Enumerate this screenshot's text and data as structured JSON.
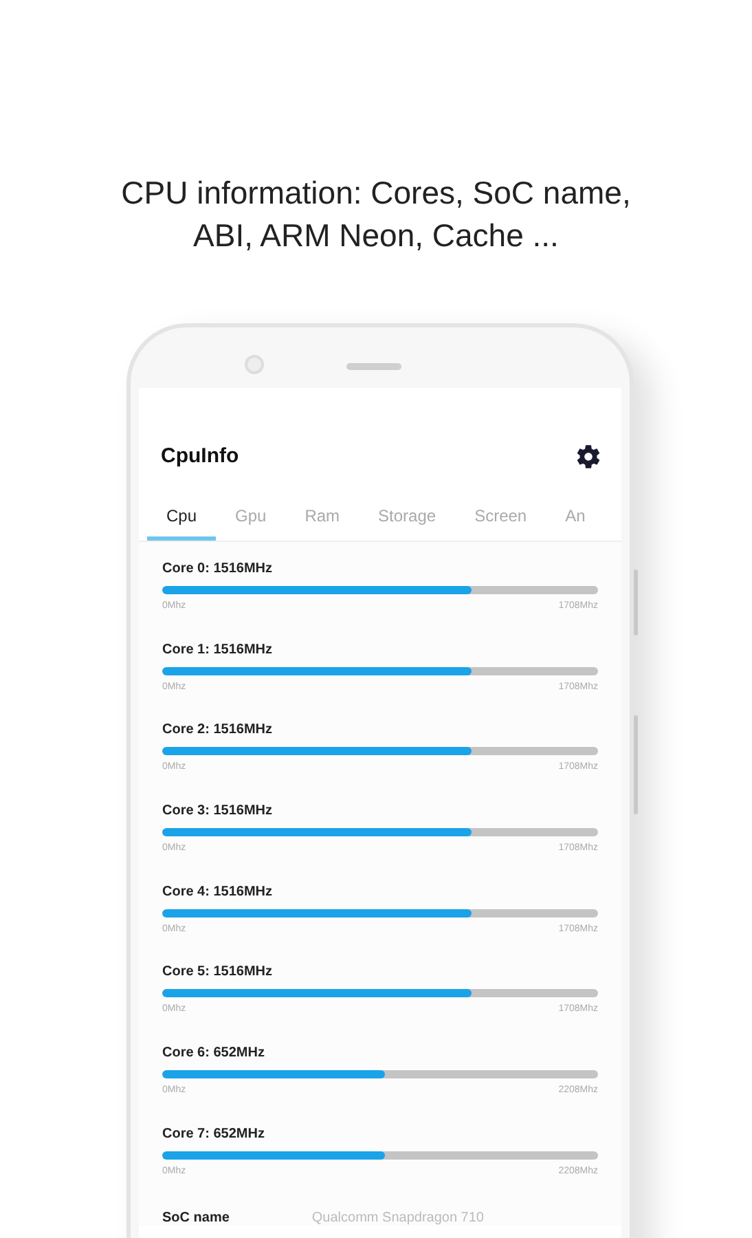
{
  "caption": [
    "CPU information: Cores, SoC name,",
    "ABI, ARM Neon, Cache ..."
  ],
  "app_bar": {
    "title": "CpuInfo"
  },
  "tabs": [
    {
      "label": "Cpu",
      "selected": true
    },
    {
      "label": "Gpu",
      "selected": false
    },
    {
      "label": "Ram",
      "selected": false
    },
    {
      "label": "Storage",
      "selected": false
    },
    {
      "label": "Screen",
      "selected": false
    },
    {
      "label": "An",
      "selected": false
    }
  ],
  "cores": [
    {
      "label": "Core 0: 1516MHz",
      "level": 0.71,
      "min": "0Mhz",
      "max": "1708Mhz"
    },
    {
      "label": "Core 1: 1516MHz",
      "level": 0.71,
      "min": "0Mhz",
      "max": "1708Mhz"
    },
    {
      "label": "Core 2: 1516MHz",
      "level": 0.71,
      "min": "0Mhz",
      "max": "1708Mhz"
    },
    {
      "label": "Core 3: 1516MHz",
      "level": 0.71,
      "min": "0Mhz",
      "max": "1708Mhz"
    },
    {
      "label": "Core 4: 1516MHz",
      "level": 0.71,
      "min": "0Mhz",
      "max": "1708Mhz"
    },
    {
      "label": "Core 5: 1516MHz",
      "level": 0.71,
      "min": "0Mhz",
      "max": "1708Mhz"
    },
    {
      "label": "Core 6: 652MHz",
      "level": 0.51,
      "min": "0Mhz",
      "max": "2208Mhz"
    },
    {
      "label": "Core 7: 652MHz",
      "level": 0.51,
      "min": "0Mhz",
      "max": "2208Mhz"
    }
  ],
  "info": [
    {
      "label": "SoC name",
      "value": "Qualcomm Snapdragon 710"
    }
  ]
}
